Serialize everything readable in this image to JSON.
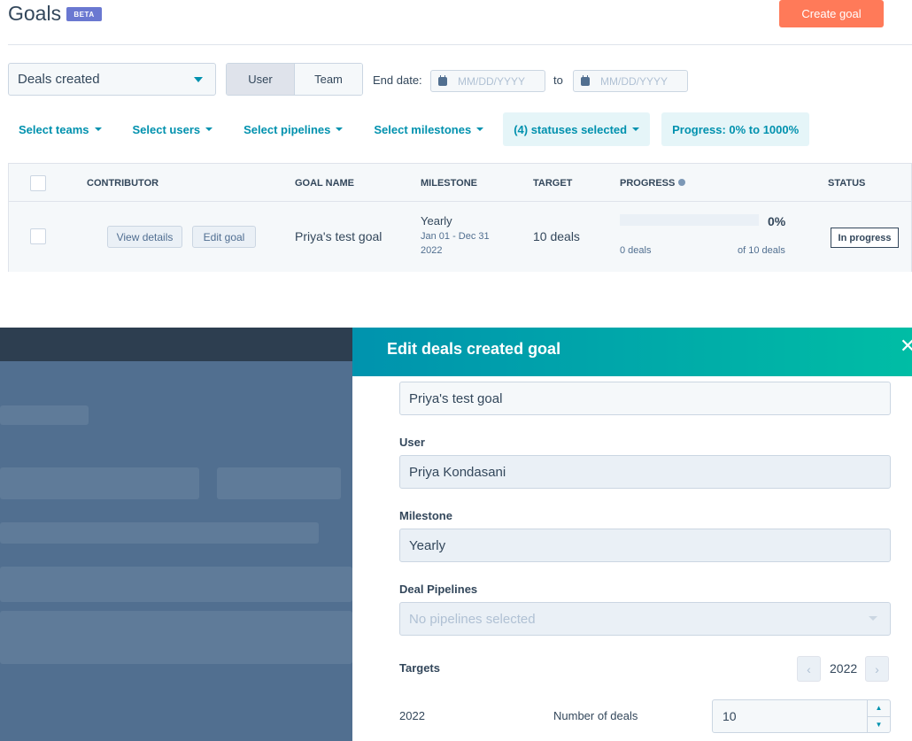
{
  "header": {
    "title": "Goals",
    "beta_badge": "BETA",
    "create_button": "Create goal"
  },
  "toolbar": {
    "goal_type": "Deals created",
    "segment": {
      "user": "User",
      "team": "Team",
      "active": "User"
    },
    "end_date_label": "End date:",
    "start_placeholder": "MM/DD/YYYY",
    "to_label": "to",
    "end_placeholder": "MM/DD/YYYY"
  },
  "filters": {
    "teams": "Select teams",
    "users": "Select users",
    "pipelines": "Select pipelines",
    "milestones": "Select milestones",
    "statuses": "(4) statuses selected",
    "progress": "Progress: 0% to 1000%"
  },
  "table": {
    "columns": {
      "contributor": "CONTRIBUTOR",
      "goal_name": "GOAL NAME",
      "milestone": "MILESTONE",
      "target": "TARGET",
      "progress": "PROGRESS",
      "status": "STATUS"
    },
    "row": {
      "view_details": "View details",
      "edit_goal": "Edit goal",
      "goal_name": "Priya's test goal",
      "milestone": "Yearly",
      "milestone_range": "Jan 01 - Dec 31",
      "milestone_year": "2022",
      "target": "10 deals",
      "progress_percent": "0%",
      "progress_fraction": 0,
      "progress_current": "0 deals",
      "progress_total": "of 10 deals",
      "status": "In progress"
    }
  },
  "panel": {
    "title": "Edit deals created goal",
    "goal_name_value": "Priya's test goal",
    "user_label": "User",
    "user_value": "Priya Kondasani",
    "milestone_label": "Milestone",
    "milestone_value": "Yearly",
    "pipelines_label": "Deal Pipelines",
    "pipelines_placeholder": "No pipelines selected",
    "targets_label": "Targets",
    "targets_year": "2022",
    "target_row_year": "2022",
    "target_row_label": "Number of deals",
    "target_row_value": "10"
  },
  "icons": {
    "close": "close-icon",
    "calendar": "calendar-icon",
    "info": "info-icon",
    "prev": "chevron-left-icon",
    "next": "chevron-right-icon"
  },
  "colors": {
    "accent": "#0091ae",
    "create_button": "#ff7a59",
    "beta_badge": "#6a78d1",
    "panel_header_start": "#0093ae",
    "panel_header_end": "#00bda5"
  }
}
